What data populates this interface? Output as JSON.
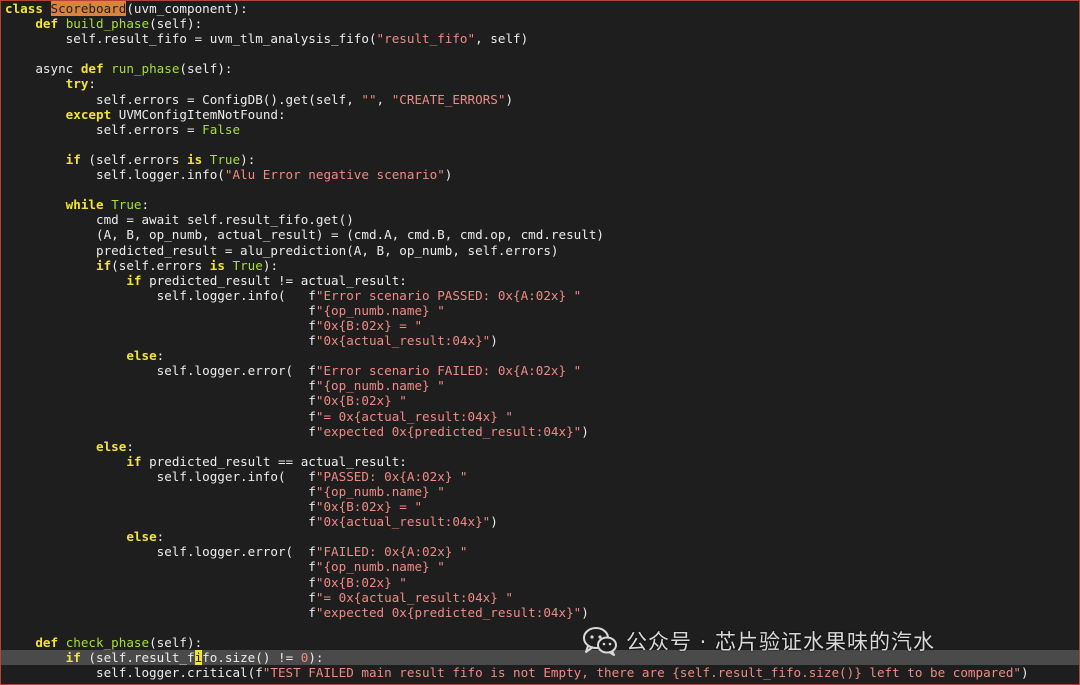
{
  "editor": {
    "lines": [
      [
        [
          "kw",
          "class"
        ],
        [
          "t",
          " "
        ],
        [
          "hl",
          "Scoreboard"
        ],
        [
          "t",
          "(uvm_component):"
        ]
      ],
      [
        [
          "t",
          "    "
        ],
        [
          "kw",
          "def"
        ],
        [
          "t",
          " "
        ],
        [
          "fn",
          "build_phase"
        ],
        [
          "t",
          "(self):"
        ]
      ],
      [
        [
          "t",
          "        self.result_fifo = uvm_tlm_analysis_fifo("
        ],
        [
          "str",
          "\"result_fifo\""
        ],
        [
          "t",
          ", self)"
        ]
      ],
      [],
      [
        [
          "t",
          "    async "
        ],
        [
          "kw",
          "def"
        ],
        [
          "t",
          " "
        ],
        [
          "fn",
          "run_phase"
        ],
        [
          "t",
          "(self):"
        ]
      ],
      [
        [
          "t",
          "        "
        ],
        [
          "kw",
          "try"
        ],
        [
          "t",
          ":"
        ]
      ],
      [
        [
          "t",
          "            self.errors = ConfigDB().get(self, "
        ],
        [
          "str",
          "\"\""
        ],
        [
          "t",
          ", "
        ],
        [
          "str",
          "\"CREATE_ERRORS\""
        ],
        [
          "t",
          ")"
        ]
      ],
      [
        [
          "t",
          "        "
        ],
        [
          "kw",
          "except"
        ],
        [
          "t",
          " UVMConfigItemNotFound:"
        ]
      ],
      [
        [
          "t",
          "            self.errors = "
        ],
        [
          "con",
          "False"
        ]
      ],
      [],
      [
        [
          "t",
          "        "
        ],
        [
          "kw",
          "if"
        ],
        [
          "t",
          " (self.errors "
        ],
        [
          "kw",
          "is"
        ],
        [
          "t",
          " "
        ],
        [
          "con",
          "True"
        ],
        [
          "t",
          "):"
        ]
      ],
      [
        [
          "t",
          "            self.logger.info("
        ],
        [
          "str",
          "\"Alu Error negative scenario\""
        ],
        [
          "t",
          ")"
        ]
      ],
      [],
      [
        [
          "t",
          "        "
        ],
        [
          "kw",
          "while"
        ],
        [
          "t",
          " "
        ],
        [
          "con",
          "True"
        ],
        [
          "t",
          ":"
        ]
      ],
      [
        [
          "t",
          "            cmd = await self.result_fifo.get()"
        ]
      ],
      [
        [
          "t",
          "            (A, B, op_numb, actual_result) = (cmd.A, cmd.B, cmd.op, cmd.result)"
        ]
      ],
      [
        [
          "t",
          "            predicted_result = alu_prediction(A, B, op_numb, self.errors)"
        ]
      ],
      [
        [
          "t",
          "            "
        ],
        [
          "kw",
          "if"
        ],
        [
          "t",
          "(self.errors "
        ],
        [
          "kw",
          "is"
        ],
        [
          "t",
          " "
        ],
        [
          "con",
          "True"
        ],
        [
          "t",
          "):"
        ]
      ],
      [
        [
          "t",
          "                "
        ],
        [
          "kw",
          "if"
        ],
        [
          "t",
          " predicted_result != actual_result:"
        ]
      ],
      [
        [
          "t",
          "                    self.logger.info(   f"
        ],
        [
          "str",
          "\"Error scenario PASSED: 0x{A:02x} \""
        ]
      ],
      [
        [
          "t",
          "                                        f"
        ],
        [
          "str",
          "\"{op_numb.name} \""
        ]
      ],
      [
        [
          "t",
          "                                        f"
        ],
        [
          "str",
          "\"0x{B:02x} = \""
        ]
      ],
      [
        [
          "t",
          "                                        f"
        ],
        [
          "str",
          "\"0x{actual_result:04x}\""
        ],
        [
          "t",
          ")"
        ]
      ],
      [
        [
          "t",
          "                "
        ],
        [
          "kw",
          "else"
        ],
        [
          "t",
          ":"
        ]
      ],
      [
        [
          "t",
          "                    self.logger.error(  f"
        ],
        [
          "str",
          "\"Error scenario FAILED: 0x{A:02x} \""
        ]
      ],
      [
        [
          "t",
          "                                        f"
        ],
        [
          "str",
          "\"{op_numb.name} \""
        ]
      ],
      [
        [
          "t",
          "                                        f"
        ],
        [
          "str",
          "\"0x{B:02x} \""
        ]
      ],
      [
        [
          "t",
          "                                        f"
        ],
        [
          "str",
          "\"= 0x{actual_result:04x} \""
        ]
      ],
      [
        [
          "t",
          "                                        f"
        ],
        [
          "str",
          "\"expected 0x{predicted_result:04x}\""
        ],
        [
          "t",
          ")"
        ]
      ],
      [
        [
          "t",
          "            "
        ],
        [
          "kw",
          "else"
        ],
        [
          "t",
          ":"
        ]
      ],
      [
        [
          "t",
          "                "
        ],
        [
          "kw",
          "if"
        ],
        [
          "t",
          " predicted_result == actual_result:"
        ]
      ],
      [
        [
          "t",
          "                    self.logger.info(   f"
        ],
        [
          "str",
          "\"PASSED: 0x{A:02x} \""
        ]
      ],
      [
        [
          "t",
          "                                        f"
        ],
        [
          "str",
          "\"{op_numb.name} \""
        ]
      ],
      [
        [
          "t",
          "                                        f"
        ],
        [
          "str",
          "\"0x{B:02x} = \""
        ]
      ],
      [
        [
          "t",
          "                                        f"
        ],
        [
          "str",
          "\"0x{actual_result:04x}\""
        ],
        [
          "t",
          ")"
        ]
      ],
      [
        [
          "t",
          "                "
        ],
        [
          "kw",
          "else"
        ],
        [
          "t",
          ":"
        ]
      ],
      [
        [
          "t",
          "                    self.logger.error(  f"
        ],
        [
          "str",
          "\"FAILED: 0x{A:02x} \""
        ]
      ],
      [
        [
          "t",
          "                                        f"
        ],
        [
          "str",
          "\"{op_numb.name} \""
        ]
      ],
      [
        [
          "t",
          "                                        f"
        ],
        [
          "str",
          "\"0x{B:02x} \""
        ]
      ],
      [
        [
          "t",
          "                                        f"
        ],
        [
          "str",
          "\"= 0x{actual_result:04x} \""
        ]
      ],
      [
        [
          "t",
          "                                        f"
        ],
        [
          "str",
          "\"expected 0x{predicted_result:04x}\""
        ],
        [
          "t",
          ")"
        ]
      ],
      [],
      [
        [
          "t",
          "    "
        ],
        [
          "kw",
          "def"
        ],
        [
          "t",
          " "
        ],
        [
          "fn",
          "check_phase"
        ],
        [
          "t",
          "(self):"
        ]
      ],
      [
        [
          "t",
          "        "
        ],
        [
          "kw",
          "if"
        ],
        [
          "t",
          " (self.result_f"
        ],
        [
          "cursor",
          "i"
        ],
        [
          "t",
          "fo.size() != "
        ],
        [
          "num",
          "0"
        ],
        [
          "t",
          "):"
        ]
      ],
      [
        [
          "t",
          "            self.logger.critical(f"
        ],
        [
          "str",
          "\"TEST FAILED main result fifo is not Empty, there are {self.result_fifo.size()} left to be compared\""
        ],
        [
          "t",
          ")"
        ]
      ]
    ],
    "current_line_index": 43
  },
  "watermark": {
    "icon": "wechat-icon",
    "text": "公众号 · 芯片验证水果味的汽水"
  }
}
